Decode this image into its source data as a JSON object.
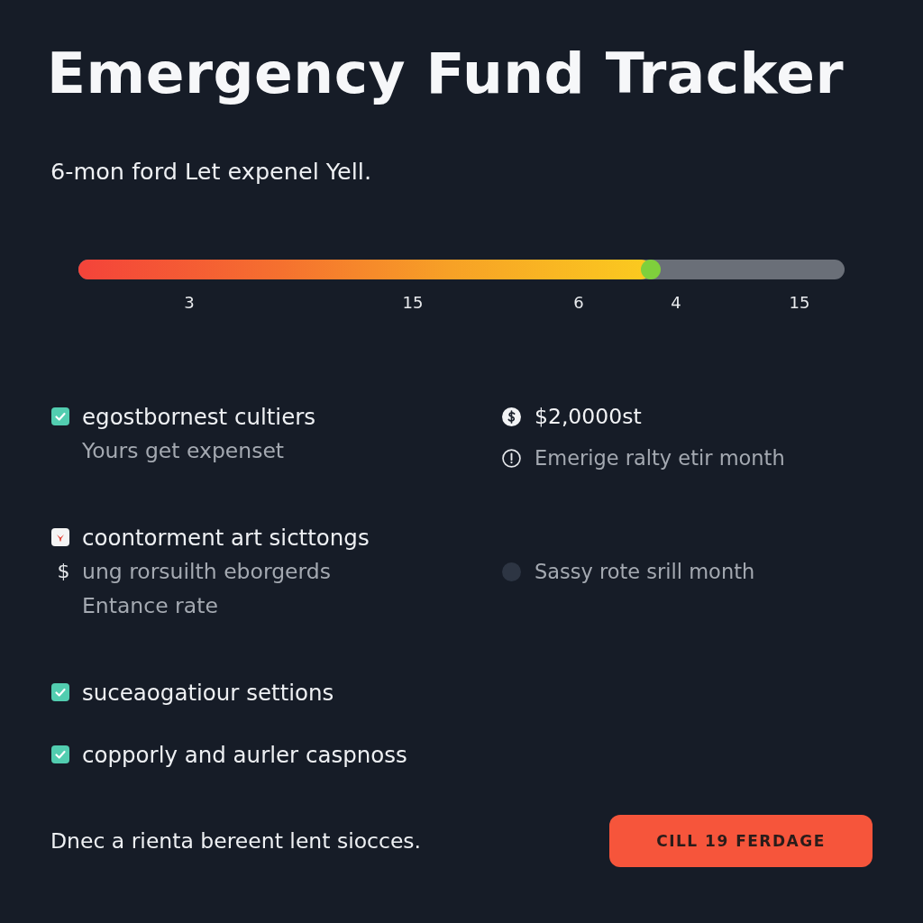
{
  "title": "Emergency Fund Tracker",
  "subtitle": "6-mon ford Let expenel Yell.",
  "progress": {
    "level": 0.747,
    "ticks": [
      "3",
      "15",
      "6",
      "4",
      "15"
    ]
  },
  "checklist": [
    {
      "checked": true,
      "label": "egostbornest cultiers",
      "details": [
        {
          "text": "Yours get expenset"
        }
      ]
    },
    {
      "checked": false,
      "label": "coontorment art sicttongs",
      "details": [
        {
          "marker": "$",
          "text": "ung rorsuilth eborgerds"
        },
        {
          "text": "Entance rate"
        }
      ]
    },
    {
      "checked": true,
      "label": "suceaogatiour settions"
    },
    {
      "checked": true,
      "label": "copporly and aurler caspnoss"
    }
  ],
  "summary": [
    {
      "lines": [
        {
          "kind": "dollar",
          "text": "$2,0000st"
        },
        {
          "kind": "alert",
          "text": "Emerige ralty etir month"
        }
      ]
    },
    {
      "lines": [
        {
          "kind": "dot",
          "text": "Sassy rote srill month"
        }
      ]
    }
  ],
  "footer": {
    "message": "Dnec a rienta bereent lent siocces.",
    "button": "CILL 19 FERDAGE"
  }
}
